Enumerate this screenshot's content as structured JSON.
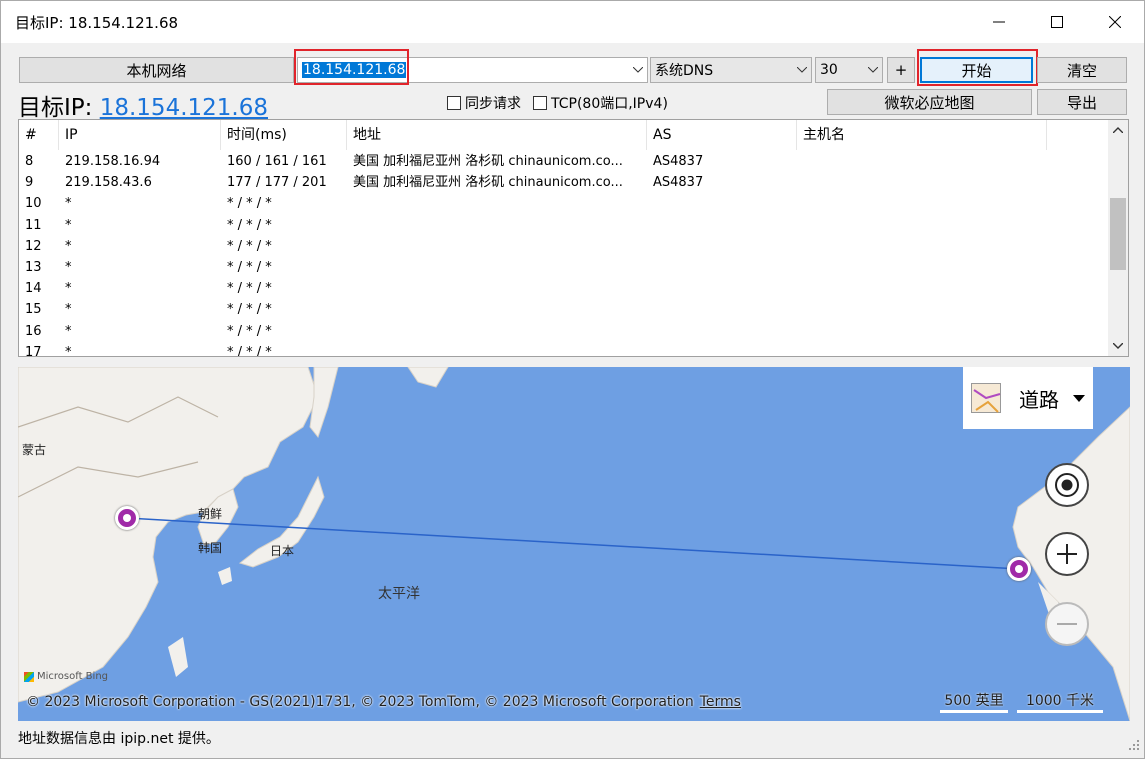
{
  "window": {
    "title": "目标IP: 18.154.121.68"
  },
  "toolbar": {
    "local_network_label": "本机网络",
    "target_input_value": "18.154.121.68",
    "dns_value": "系统DNS",
    "hops_value": "30",
    "plus_label": "+",
    "start_label": "开始",
    "clear_label": "清空",
    "bing_map_label": "微软必应地图",
    "export_label": "导出"
  },
  "target": {
    "prefix": "目标IP: ",
    "ip": "18.154.121.68"
  },
  "options": {
    "sync_request_label": "同步请求",
    "tcp_label": "TCP(80端口,IPv4)",
    "sync_request_checked": false,
    "tcp_checked": false
  },
  "table": {
    "columns": [
      "#",
      "IP",
      "时间(ms)",
      "地址",
      "AS",
      "主机名"
    ],
    "rows": [
      {
        "n": "8",
        "ip": "219.158.16.94",
        "time": "160 / 161 / 161",
        "addr": "美国 加利福尼亚州 洛杉矶 chinaunicom.co...",
        "as": "AS4837",
        "host": ""
      },
      {
        "n": "9",
        "ip": "219.158.43.6",
        "time": "177 / 177 / 201",
        "addr": "美国 加利福尼亚州 洛杉矶 chinaunicom.co...",
        "as": "AS4837",
        "host": ""
      },
      {
        "n": "10",
        "ip": "*",
        "time": "* / * / *",
        "addr": "",
        "as": "",
        "host": ""
      },
      {
        "n": "11",
        "ip": "*",
        "time": "* / * / *",
        "addr": "",
        "as": "",
        "host": ""
      },
      {
        "n": "12",
        "ip": "*",
        "time": "* / * / *",
        "addr": "",
        "as": "",
        "host": ""
      },
      {
        "n": "13",
        "ip": "*",
        "time": "* / * / *",
        "addr": "",
        "as": "",
        "host": ""
      },
      {
        "n": "14",
        "ip": "*",
        "time": "* / * / *",
        "addr": "",
        "as": "",
        "host": ""
      },
      {
        "n": "15",
        "ip": "*",
        "time": "* / * / *",
        "addr": "",
        "as": "",
        "host": ""
      },
      {
        "n": "16",
        "ip": "*",
        "time": "* / * / *",
        "addr": "",
        "as": "",
        "host": ""
      },
      {
        "n": "17",
        "ip": "*",
        "time": "* / * / *",
        "addr": "",
        "as": "",
        "host": ""
      }
    ]
  },
  "map": {
    "style_label": "道路",
    "labels": {
      "mongolia": "蒙古",
      "korea_n": "朝鲜",
      "korea_s": "韩国",
      "japan": "日本",
      "pacific": "太平洋"
    },
    "copyright": "© 2023 Microsoft Corporation - GS(2021)1731, © 2023 TomTom, © 2023 Microsoft Corporation",
    "terms": "Terms",
    "bing_logo": "Microsoft Bing",
    "scale_miles": "500 英里",
    "scale_km": "1000 千米",
    "ocean_color": "#6e9fe3",
    "land_color": "#f2f0ec",
    "route_color": "#2a63c9",
    "pin_color": "#a02aa8"
  },
  "status": {
    "text": "地址数据信息由 ipip.net 提供。"
  },
  "colors": {
    "link": "#1a73d9",
    "highlight_box": "#e0242b",
    "selection": "#0078d7"
  }
}
